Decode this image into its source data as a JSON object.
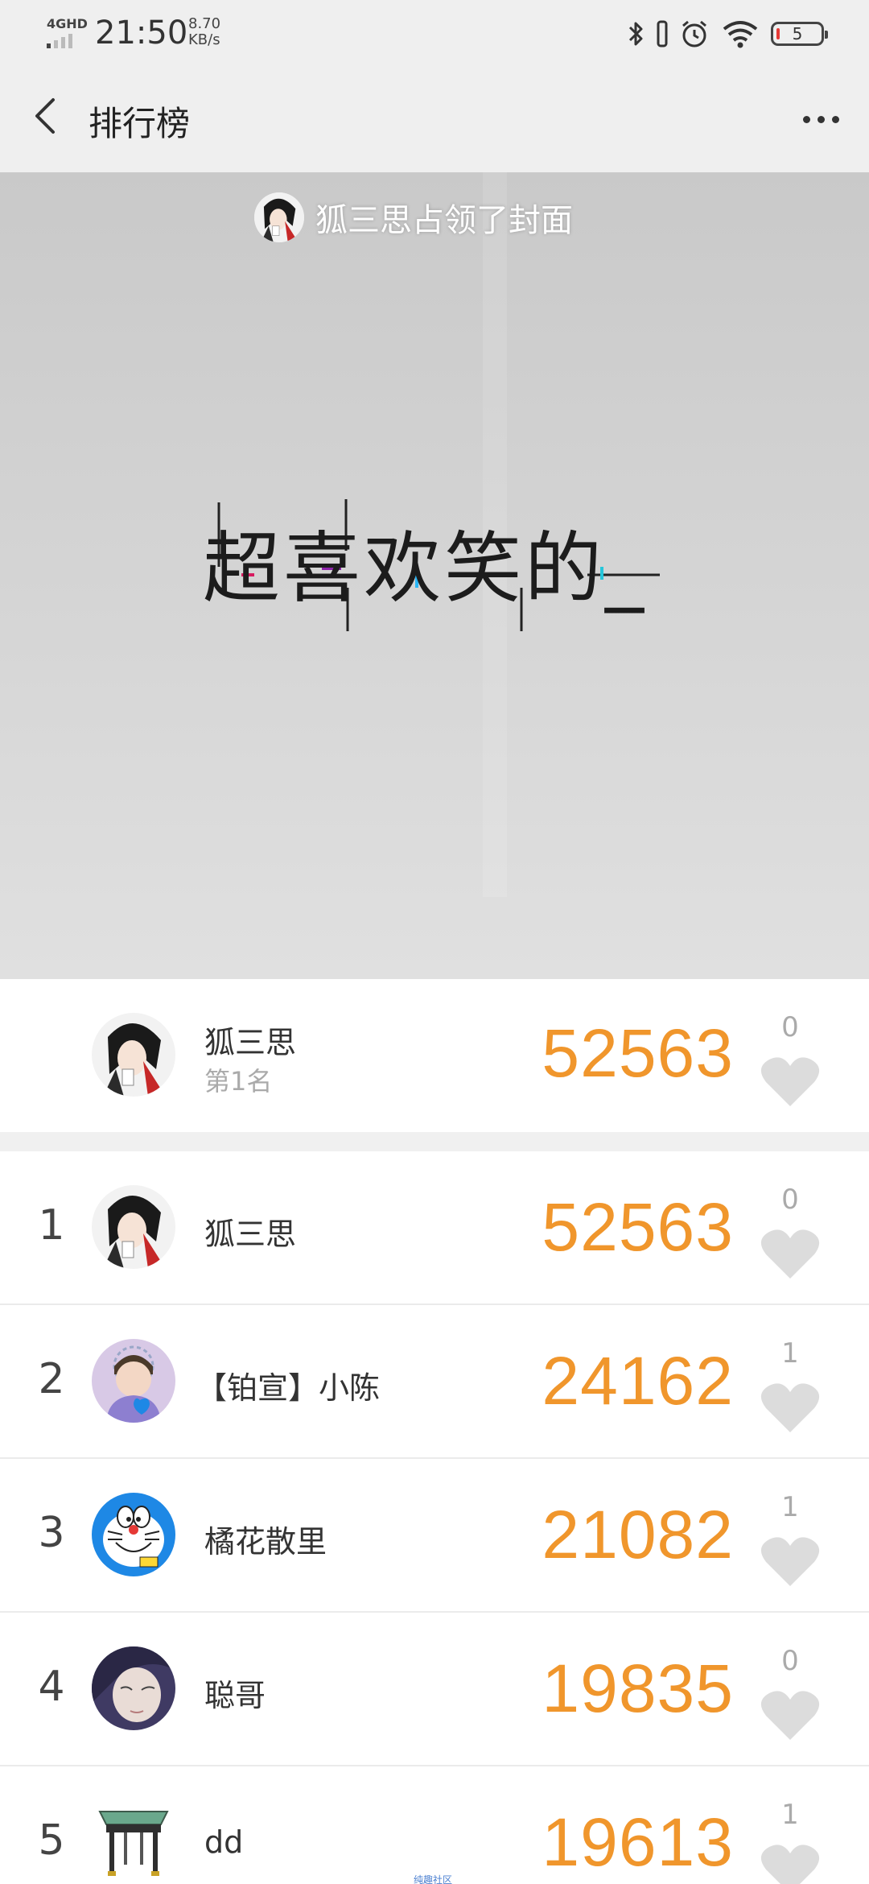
{
  "status_bar": {
    "network": "4GHD",
    "time": "21:50",
    "speed_value": "8.70",
    "speed_unit": "KB/s",
    "battery": "5",
    "icons": [
      "bluetooth-icon",
      "vibrate-icon",
      "alarm-icon",
      "wifi-icon",
      "battery-icon"
    ]
  },
  "nav": {
    "title": "排行榜",
    "back_icon": "chevron-left-icon",
    "more_icon": "more-dots-icon"
  },
  "cover": {
    "owner_text": "狐三思占领了封面",
    "slogan": "超喜欢笑的_"
  },
  "my_rank": {
    "name": "狐三思",
    "rank_label": "第1名",
    "score": "52563",
    "likes": "0"
  },
  "leaderboard": [
    {
      "rank": "1",
      "name": "狐三思",
      "score": "52563",
      "likes": "0"
    },
    {
      "rank": "2",
      "name": "【铂宣】小陈",
      "score": "24162",
      "likes": "1"
    },
    {
      "rank": "3",
      "name": "橘花散里",
      "score": "21082",
      "likes": "1"
    },
    {
      "rank": "4",
      "name": "聪哥",
      "score": "19835",
      "likes": "0"
    },
    {
      "rank": "5",
      "name": "dd",
      "score": "19613",
      "likes": "1"
    }
  ],
  "watermark": "纯趣社区",
  "colors": {
    "score": "#f0962c",
    "header_bg": "#efefef",
    "muted": "#aaaaaa"
  }
}
